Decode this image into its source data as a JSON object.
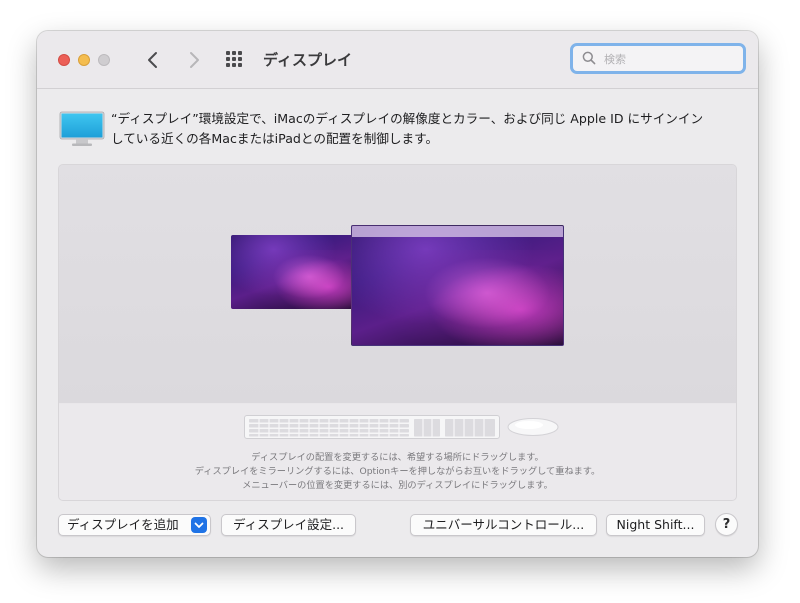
{
  "window": {
    "title": "ディスプレイ"
  },
  "search": {
    "placeholder": "検索"
  },
  "description": {
    "line1": "“ディスプレイ”環境設定で、iMacのディスプレイの解像度とカラー、および同じ Apple ID にサインイン",
    "line2": "している近くの各MacまたはiPadとの配置を制御します。"
  },
  "arrangement": {
    "hint1": "ディスプレイの配置を変更するには、希望する場所にドラッグします。",
    "hint2": "ディスプレイをミラーリングするには、Optionキーを押しながらお互いをドラッグして重ねます。",
    "hint3": "メニューバーの位置を変更するには、別のディスプレイにドラッグします。"
  },
  "buttons": {
    "add_display": "ディスプレイを追加",
    "display_settings": "ディスプレイ設定...",
    "universal_control": "ユニバーサルコントロール...",
    "night_shift": "Night Shift...",
    "help": "?"
  },
  "icons": {
    "back": "chevron-left-icon",
    "forward": "chevron-right-icon",
    "show_all": "grid-icon",
    "search": "search-icon",
    "display": "display-icon",
    "popup": "chevron-down-icon",
    "keyboard": "keyboard-icon",
    "mouse": "mouse-icon"
  },
  "colors": {
    "accent": "#1f73e6",
    "search_focus_ring": "#7fb3ea",
    "close": "#ec5f57",
    "minimize": "#f4bd4f",
    "zoom_disabled": "#cfcdd0"
  }
}
